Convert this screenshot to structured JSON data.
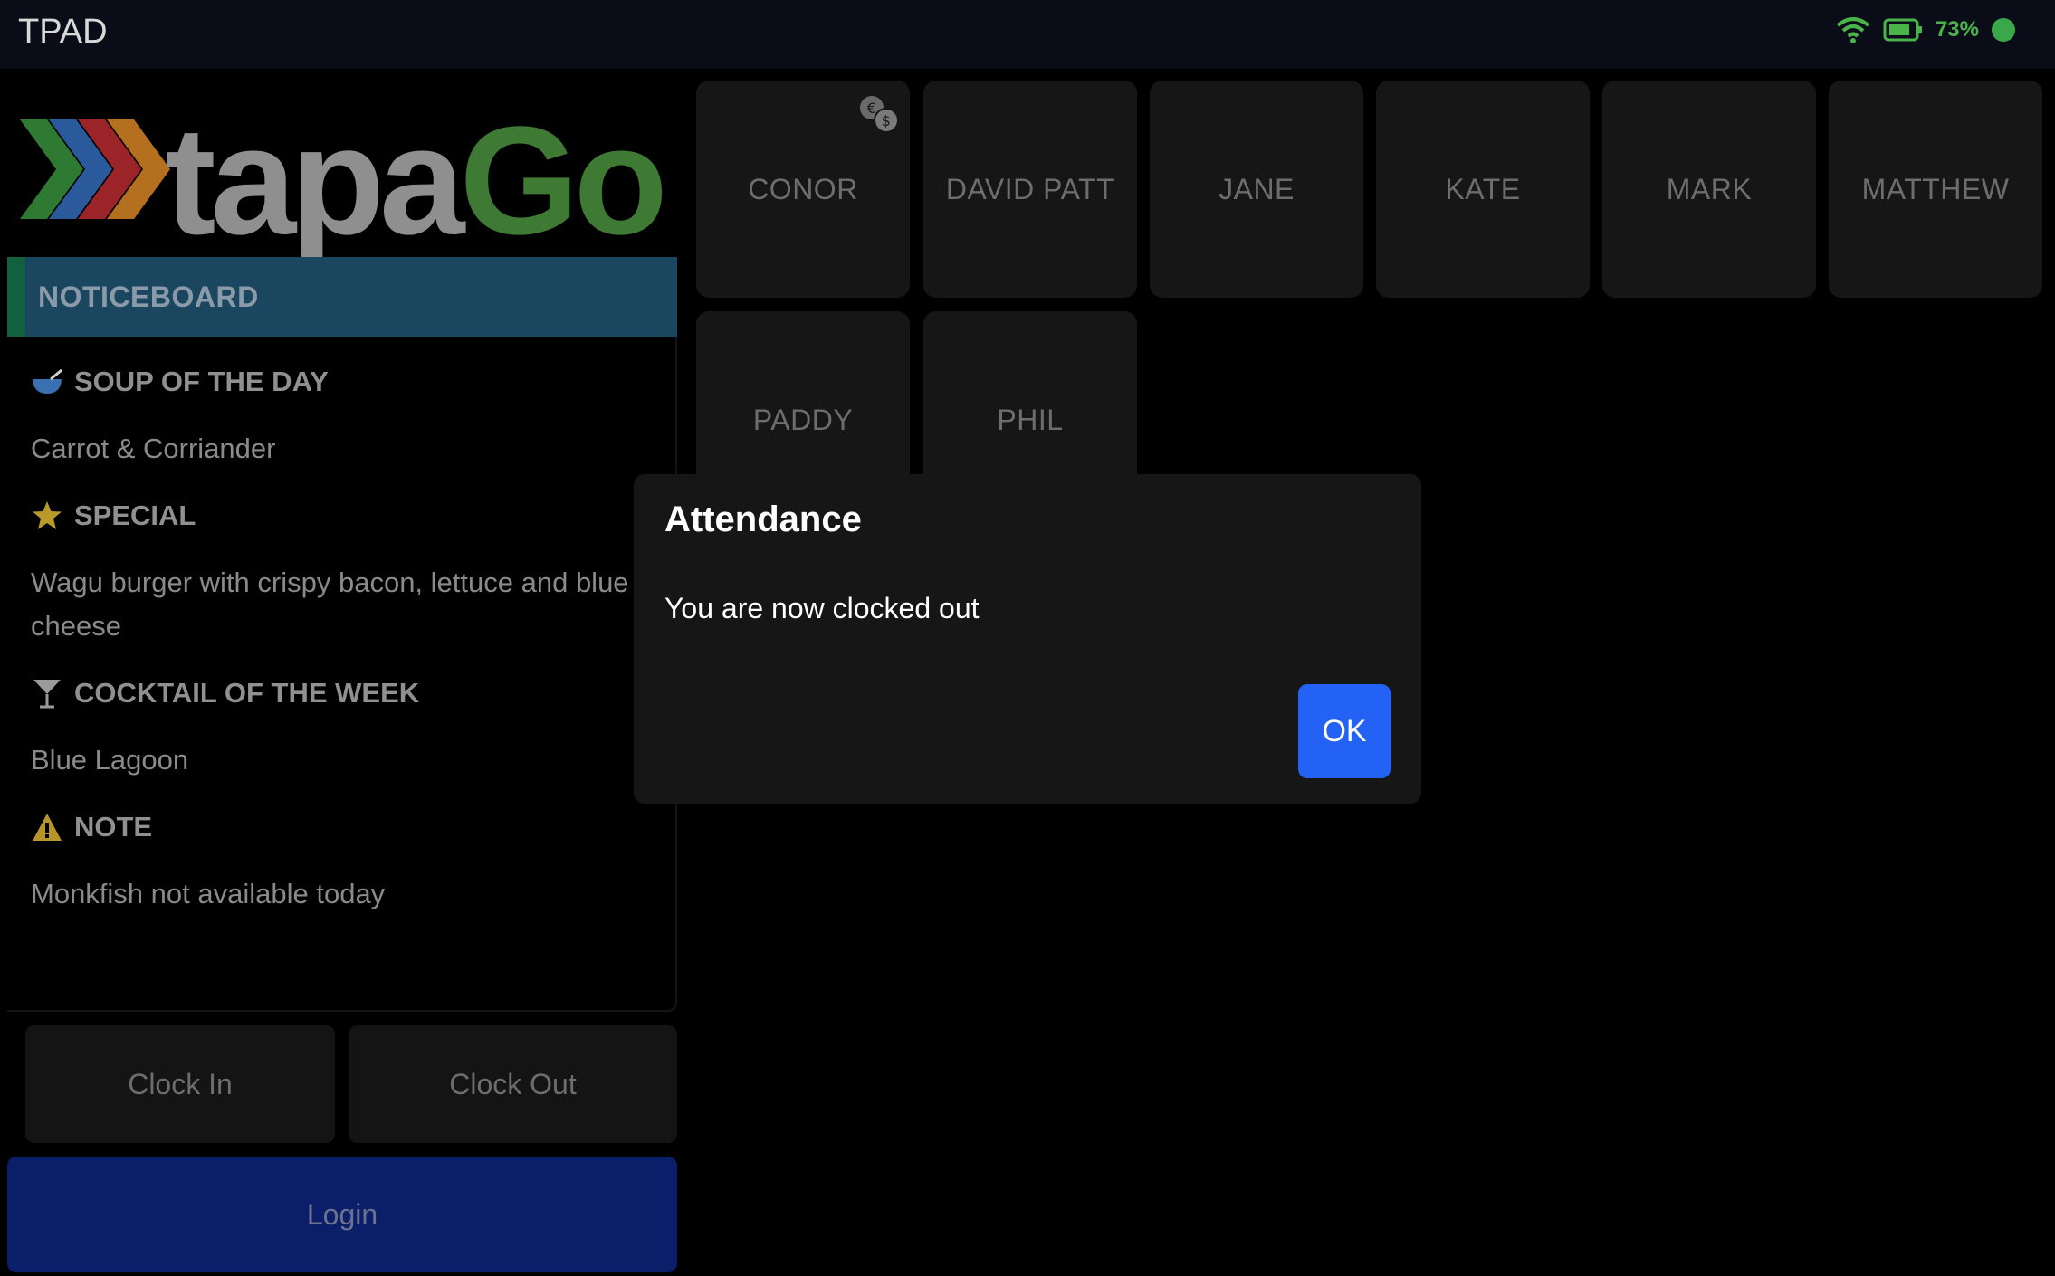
{
  "statusbar": {
    "app_name": "TPAD",
    "battery_pct": "73%",
    "wifi_icon": "wifi-icon",
    "battery_icon": "battery-icon"
  },
  "logo": {
    "tapa": "tapa",
    "go": "Go",
    "colors": {
      "tapa": "#8f8f8f",
      "go": "#3f7a34",
      "chevrons": [
        "#2f7a32",
        "#2a5a9c",
        "#9a2428",
        "#b4701e"
      ]
    }
  },
  "noticeboard": {
    "header": "NOTICEBOARD",
    "items": [
      {
        "icon": "soup-bowl-icon",
        "title": "SOUP OF THE DAY",
        "text": "Carrot & Corriander"
      },
      {
        "icon": "star-icon",
        "title": "SPECIAL",
        "text": "Wagu burger with crispy bacon, lettuce and blue cheese"
      },
      {
        "icon": "cocktail-icon",
        "title": "COCKTAIL OF THE WEEK",
        "text": "Blue Lagoon"
      },
      {
        "icon": "warning-icon",
        "title": "NOTE",
        "text": "Monkfish not available today"
      }
    ]
  },
  "employees": [
    "CONOR",
    "DAVID PATT",
    "JANE",
    "KATE",
    "MARK",
    "MATTHEW",
    "PADDY",
    "PHIL"
  ],
  "buttons": {
    "clock_in": "Clock In",
    "clock_out": "Clock Out",
    "login": "Login"
  },
  "dialog": {
    "title": "Attendance",
    "message": "You are now clocked out",
    "ok": "OK"
  },
  "colors": {
    "accent": "#2461f5",
    "login": "#0b1e6a",
    "noticeboard_header": "#1b4660"
  }
}
